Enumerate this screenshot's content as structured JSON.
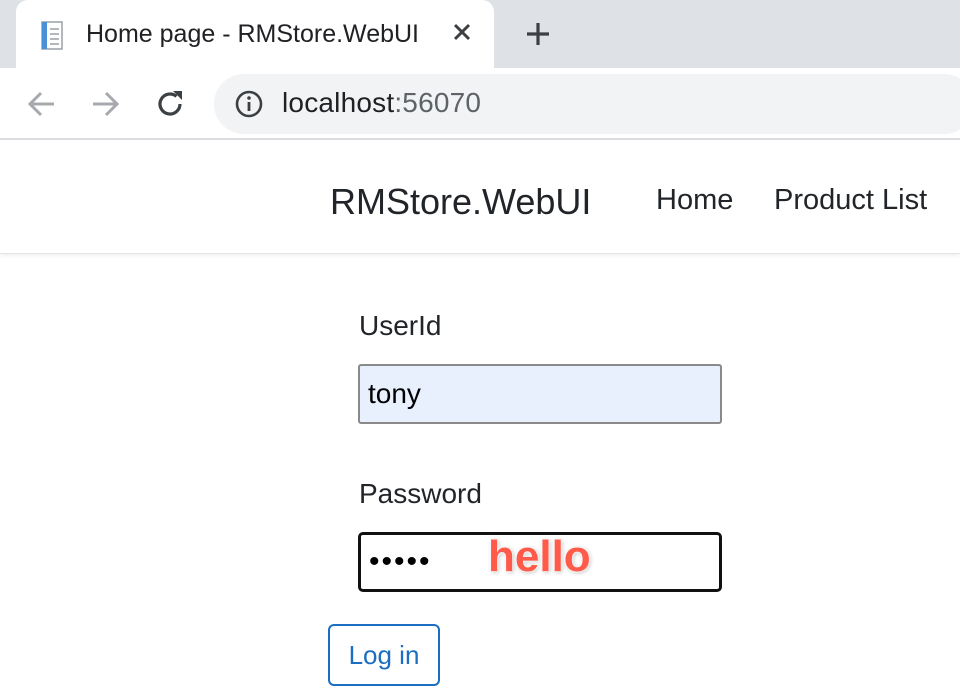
{
  "browser": {
    "tab_title": "Home page - RMStore.WebUI",
    "url_host": "localhost",
    "url_port": ":56070"
  },
  "site": {
    "brand": "RMStore.WebUI",
    "nav": {
      "home": "Home",
      "product_list": "Product List"
    }
  },
  "login_form": {
    "userid_label": "UserId",
    "userid_value": "tony",
    "password_label": "Password",
    "password_value": "hello",
    "password_overlay": "hello",
    "submit_label": "Log in"
  },
  "icons": {
    "favicon": "page-document-icon",
    "tab_close": "close-icon",
    "new_tab": "plus-icon",
    "back": "arrow-left-icon",
    "forward": "arrow-right-icon",
    "reload": "reload-icon",
    "site_info": "info-icon"
  },
  "colors": {
    "autofill_background": "#e8f0fe",
    "button_accent": "#1b6ec2",
    "overlay_text": "#ff5a4a",
    "tabstrip": "#dee1e6"
  }
}
